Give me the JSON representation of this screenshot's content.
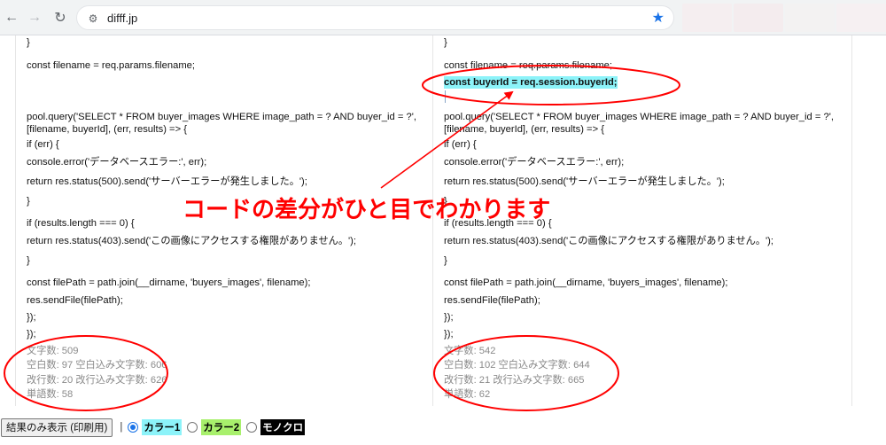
{
  "browser": {
    "url": "difff.jp"
  },
  "left": {
    "lines": [
      "}",
      "const filename = req.params.filename;",
      "pool.query('SELECT * FROM buyer_images WHERE image_path = ? AND buyer_id = ?', [filename, buyerId], (err, results) => {",
      "if (err) {",
      "console.error('データベースエラー:', err);",
      "return res.status(500).send('サーバーエラーが発生しました。');",
      "}",
      "if (results.length === 0) {",
      "return res.status(403).send('この画像にアクセスする権限がありません。');",
      "}",
      "const filePath = path.join(__dirname, 'buyers_images', filename);",
      "res.sendFile(filePath);",
      "});",
      "});"
    ],
    "stats": [
      "文字数: 509",
      "空白数: 97 空白込み文字数: 606",
      "改行数: 20 改行込み文字数: 626",
      "単語数: 58"
    ]
  },
  "right": {
    "lines": [
      "}",
      "const filename = req.params.filename;",
      "const buyerId = req.session.buyerId;",
      "pool.query('SELECT * FROM buyer_images WHERE image_path = ? AND buyer_id = ?', [filename, buyerId], (err, results) => {",
      "if (err) {",
      "console.error('データベースエラー:', err);",
      "return res.status(500).send('サーバーエラーが発生しました。');",
      "}",
      "if (results.length === 0) {",
      "return res.status(403).send('この画像にアクセスする権限がありません。');",
      "}",
      "const filePath = path.join(__dirname, 'buyers_images', filename);",
      "res.sendFile(filePath);",
      "});",
      "});"
    ],
    "stats": [
      "文字数: 542",
      "空白数: 102 空白込み文字数: 644",
      "改行数: 21 改行込み文字数: 665",
      "単語数: 62"
    ]
  },
  "annotation": {
    "text": "コードの差分がひと目でわかります",
    "color": "#ff0000"
  },
  "controls": {
    "print_button": "結果のみ表示 (印刷用)",
    "separator": "|",
    "options": [
      "カラー1",
      "カラー2",
      "モノクロ"
    ],
    "selected": "カラー1",
    "colors": {
      "highlight": "#8cf3f9",
      "color2": "#a8f06c",
      "mono": "#000000"
    }
  }
}
